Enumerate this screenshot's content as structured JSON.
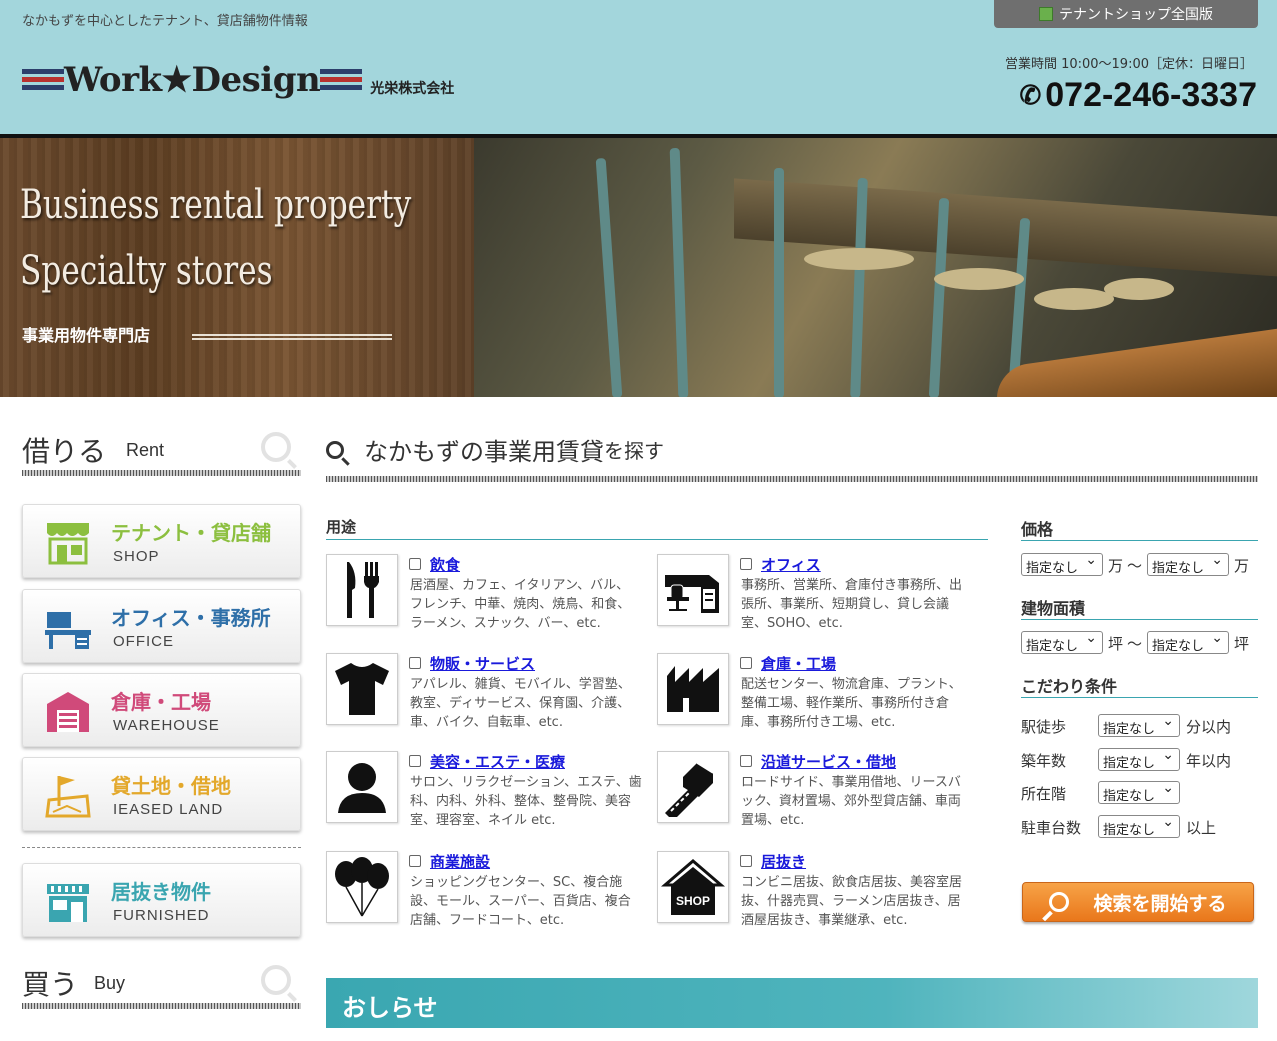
{
  "header": {
    "tagline": "なかもずを中心としたテナント、貸店舗物件情報",
    "logo_text": "Work★Design",
    "company": "光栄株式会社",
    "shop_all_label": "テナントショップ全国版",
    "hours": "営業時間 10:00〜19:00［定休：日曜日］",
    "phone": "072-246-3337"
  },
  "hero": {
    "title1": "Business rental property",
    "title2": "Specialty stores",
    "subtitle": "事業用物件専門店"
  },
  "sidebar": {
    "rent_heading": {
      "jp": "借りる",
      "en": "Rent"
    },
    "rent_items": [
      {
        "jp": "テナント・貸店舗",
        "en": "SHOP",
        "color": "#8cbf3f",
        "icon": "storefront-icon"
      },
      {
        "jp": "オフィス・事務所",
        "en": "OFFICE",
        "color": "#2e6fa8",
        "icon": "office-icon"
      },
      {
        "jp": "倉庫・工場",
        "en": "WAREHOUSE",
        "color": "#d04a7a",
        "icon": "warehouse-icon"
      },
      {
        "jp": "貸土地・借地",
        "en": "IEASED LAND",
        "color": "#e3a82b",
        "icon": "land-flag-icon"
      },
      {
        "jp": "居抜き物件",
        "en": "FURNISHED",
        "color": "#3aa5b0",
        "icon": "furnished-shop-icon"
      }
    ],
    "buy_heading": {
      "jp": "買う",
      "en": "Buy"
    }
  },
  "main": {
    "title_a": "なかもずの事業用賃貸",
    "title_b": "を探す",
    "use_label": "用途",
    "uses": [
      {
        "name": "飲食",
        "desc": "居酒屋、カフェ、イタリアン、バル、フレンチ、中華、焼肉、焼鳥、和食、ラーメン、スナック、バー、etc.",
        "icon": "fork-knife-icon"
      },
      {
        "name": "オフィス",
        "desc": "事務所、営業所、倉庫付き事務所、出張所、事業所、短期貸し、貸し会議室、SOHO、etc.",
        "icon": "desk-chair-icon"
      },
      {
        "name": "物販・サービス",
        "desc": "アパレル、雑貨、モバイル、学習塾、教室、ディサービス、保育園、介護、車、バイク、自転車、etc.",
        "icon": "tshirt-icon"
      },
      {
        "name": "倉庫・工場",
        "desc": "配送センター、物流倉庫、プラント、整備工場、軽作業所、事務所付き倉庫、事務所付き工場、etc.",
        "icon": "factory-icon"
      },
      {
        "name": "美容・エステ・医療",
        "desc": "サロン、リラクゼーション、エステ、歯科、内科、外科、整体、整骨院、美容室、理容室、ネイル etc.",
        "icon": "person-icon"
      },
      {
        "name": "沿道サービス・借地",
        "desc": "ロードサイド、事業用借地、リースバック、資材置場、郊外型貸店舗、車両置場、etc.",
        "icon": "roadside-building-icon"
      },
      {
        "name": "商業施設",
        "desc": "ショッピングセンター、SC、複合施設、モール、スーパー、百貨店、複合店舗、フードコート、etc.",
        "icon": "balloons-icon"
      },
      {
        "name": "居抜き",
        "desc": "コンビニ居抜、飲食店居抜、美容室居抜、什器売買、ラーメン店居抜き、居酒屋居抜き、事業継承、etc.",
        "icon": "shop-house-icon"
      }
    ]
  },
  "filters": {
    "price_label": "価格",
    "area_label": "建物面積",
    "extra_label": "こだわり条件",
    "none": "指定なし",
    "man": "万",
    "tilde": "〜",
    "tsubo": "坪",
    "rows": [
      {
        "label": "駅徒歩",
        "unit": "分以内"
      },
      {
        "label": "築年数",
        "unit": "年以内"
      },
      {
        "label": "所在階",
        "unit": ""
      },
      {
        "label": "駐車台数",
        "unit": "以上"
      }
    ],
    "search_label": "検索を開始する"
  },
  "news": {
    "label": "おしらせ"
  }
}
